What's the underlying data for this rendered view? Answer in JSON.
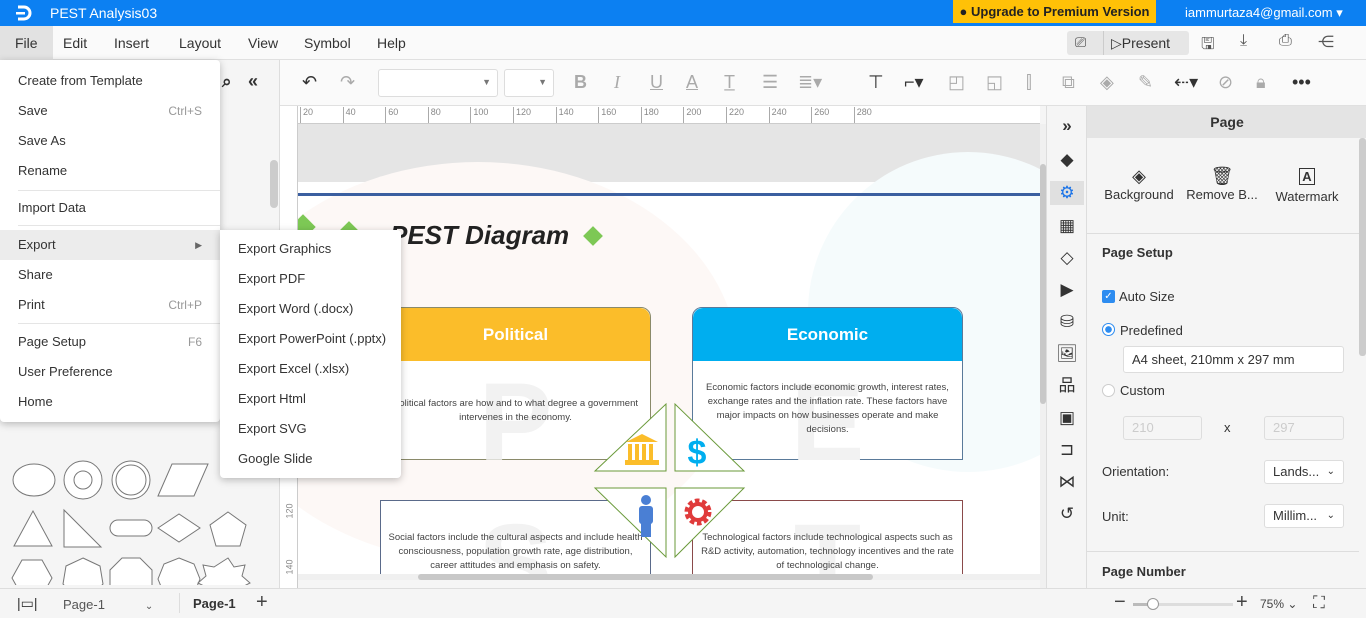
{
  "app": {
    "title": "PEST Analysis03",
    "upgrade_label": "Upgrade to Premium Version",
    "account": "iammurtaza4@gmail.com",
    "brand_color": "#0c80f2",
    "upgrade_color": "#ffc107"
  },
  "menubar": {
    "items": [
      "File",
      "Edit",
      "Insert",
      "Layout",
      "View",
      "Symbol",
      "Help"
    ],
    "present_label": "Present"
  },
  "file_menu": {
    "items": [
      {
        "label": "Create from Template",
        "shortcut": ""
      },
      {
        "label": "Save",
        "shortcut": "Ctrl+S"
      },
      {
        "label": "Save As",
        "shortcut": ""
      },
      {
        "label": "Rename",
        "shortcut": ""
      },
      {
        "label": "Import Data",
        "shortcut": ""
      },
      {
        "label": "Export",
        "shortcut": ""
      },
      {
        "label": "Share",
        "shortcut": ""
      },
      {
        "label": "Print",
        "shortcut": "Ctrl+P"
      },
      {
        "label": "Page Setup",
        "shortcut": "F6"
      },
      {
        "label": "User Preference",
        "shortcut": ""
      },
      {
        "label": "Home",
        "shortcut": ""
      }
    ]
  },
  "export_menu": {
    "items": [
      "Export Graphics",
      "Export PDF",
      "Export Word (.docx)",
      "Export PowerPoint (.pptx)",
      "Export Excel (.xlsx)",
      "Export Html",
      "Export SVG",
      "Google Slide"
    ]
  },
  "ruler": {
    "h": [
      "20",
      "40",
      "60",
      "80",
      "100",
      "120",
      "140",
      "160",
      "180",
      "200",
      "220",
      "240",
      "260",
      "280"
    ],
    "v": [
      "120",
      "140"
    ]
  },
  "diagram": {
    "title": "PEST Diagram",
    "political": {
      "title": "Political",
      "letter": "P",
      "text": "Political factors are how and to what degree a government intervenes in the economy.",
      "color": "#fbbd2a"
    },
    "economic": {
      "title": "Economic",
      "letter": "E",
      "text": "Economic factors include economic growth, interest rates, exchange rates and the inflation rate. These factors have major impacts on how businesses operate and make decisions.",
      "color": "#00aeef"
    },
    "social": {
      "letter": "S",
      "text": "Social factors include the cultural aspects and include health consciousness, population growth rate, age distribution, career attitudes and emphasis on safety."
    },
    "technological": {
      "letter": "T",
      "text": "Technological factors include technological aspects such as R&D activity, automation, technology incentives and the rate of technological change."
    }
  },
  "right_panel": {
    "title": "Page",
    "background": "Background",
    "remove_bg": "Remove B...",
    "watermark": "Watermark",
    "page_setup": "Page Setup",
    "auto_size": "Auto Size",
    "auto_size_checked": true,
    "predefined": "Predefined",
    "predefined_selected": true,
    "predefined_value": "A4 sheet, 210mm x 297 mm",
    "custom": "Custom",
    "width": "210",
    "x": "x",
    "height": "297",
    "orientation_label": "Orientation:",
    "orientation_value": "Lands...",
    "unit_label": "Unit:",
    "unit_value": "Millim...",
    "page_number": "Page Number"
  },
  "bottom": {
    "page_select": "Page-1",
    "active_tab": "Page-1",
    "zoom": "75%",
    "zoom_fraction": 0.2
  }
}
